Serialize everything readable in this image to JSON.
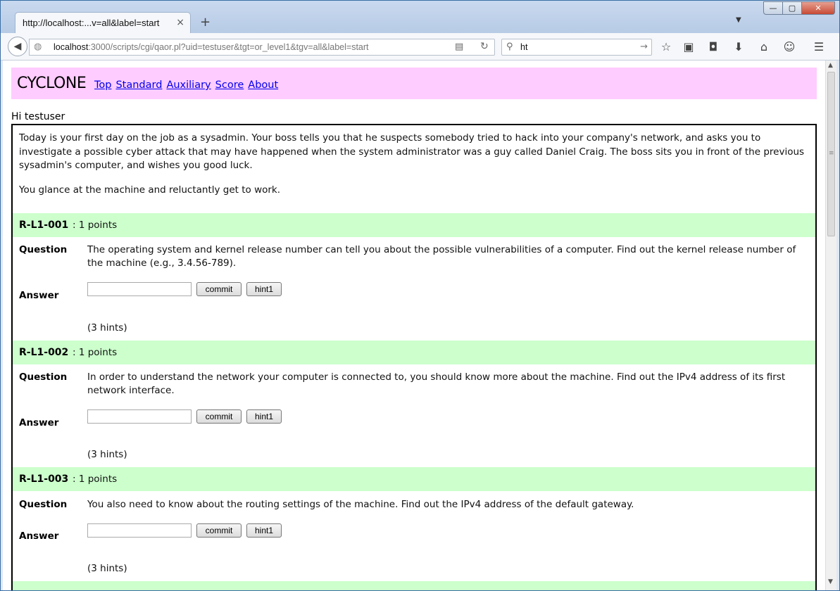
{
  "browser": {
    "tab_title": "http://localhost:...v=all&label=start",
    "tab_close": "×",
    "new_tab": "+",
    "window_controls": {
      "minimize": "—",
      "maximize": "▢",
      "close": "✕"
    },
    "url_host": "localhost",
    "url_rest": ":3000/scripts/cgi/qaor.pl?uid=testuser&tgt=or_level1&tgv=all&label=start",
    "search_value": "ht",
    "icons": [
      "back-arrow-icon",
      "globe-icon",
      "reader-icon",
      "reload-icon",
      "search-icon",
      "bookmark-star-icon",
      "reading-list-icon",
      "pocket-icon",
      "download-icon",
      "home-icon",
      "smiley-icon",
      "menu-icon"
    ]
  },
  "site": {
    "brand": "CYCLONE",
    "nav": [
      "Top",
      "Standard",
      "Auxiliary",
      "Score",
      "About"
    ],
    "greeting": "Hi testuser"
  },
  "intro": {
    "p1": "Today is your first day on the job as a sysadmin. Your boss tells you that he suspects somebody tried to hack into your company's network, and asks you to investigate a possible cyber attack that may have happened when the system administrator was a guy called Daniel Craig. The boss sits you in front of the previous sysadmin's computer, and wishes you good luck.",
    "p2": "You glance at the machine and reluctantly get to work."
  },
  "labels": {
    "question": "Question",
    "answer": "Answer",
    "commit": "commit",
    "hint": "hint1"
  },
  "questions": [
    {
      "id": "R-L1-001",
      "points": ": 1 points",
      "text": "The operating system and kernel release number can tell you about the possible vulnerabilities of a computer. Find out the kernel release number of the machine (e.g., 3.4.56-789).",
      "answer_value": "",
      "hints": "(3 hints)"
    },
    {
      "id": "R-L1-002",
      "points": ": 1 points",
      "text": "In order to understand the network your computer is connected to, you should know more about the machine. Find out the IPv4 address of its first network interface.",
      "answer_value": "",
      "hints": "(3 hints)"
    },
    {
      "id": "R-L1-003",
      "points": ": 1 points",
      "text": "You also need to know about the routing settings of the machine. Find out the IPv4 address of the default gateway.",
      "answer_value": "",
      "hints": "(3 hints)"
    }
  ]
}
